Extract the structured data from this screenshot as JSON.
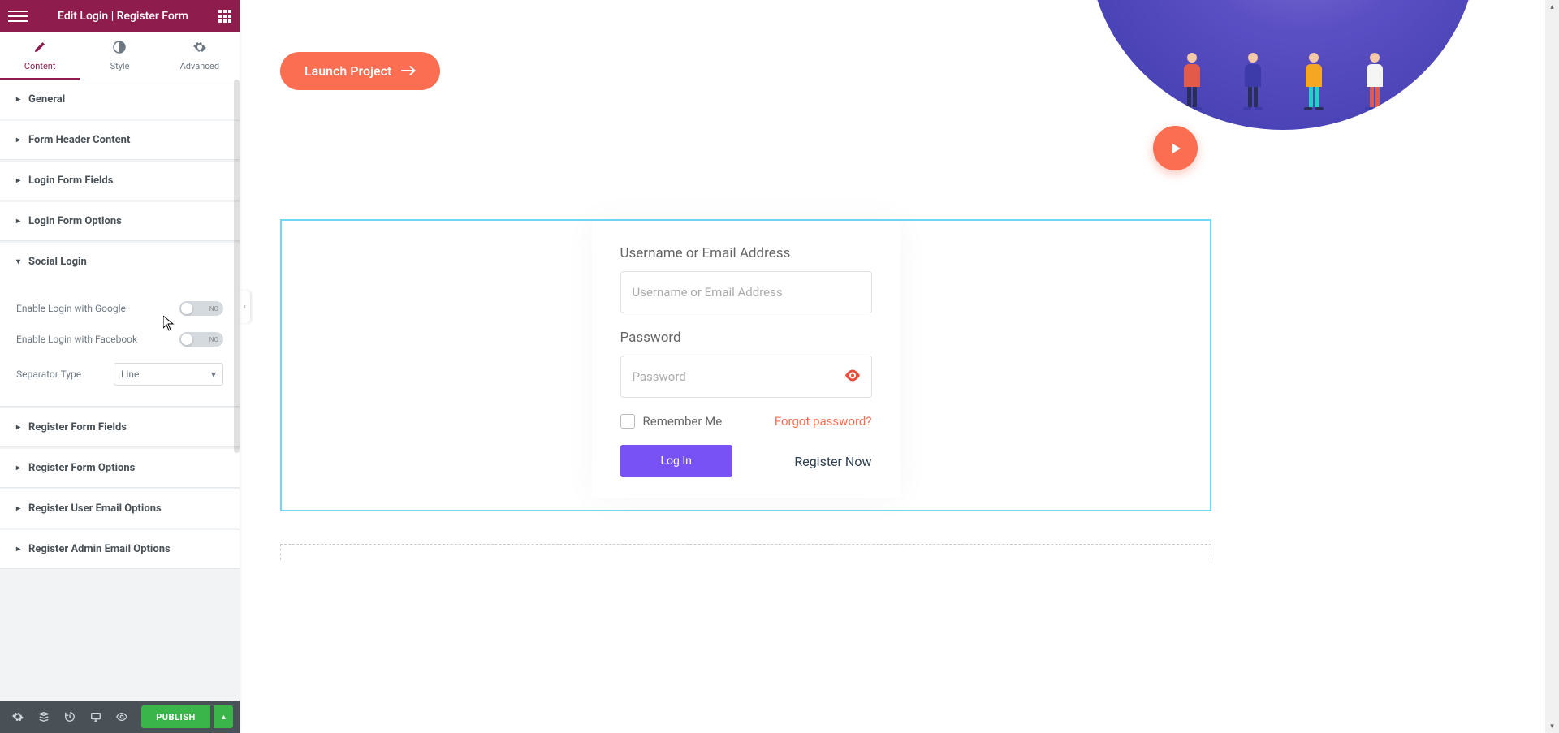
{
  "header": {
    "title": "Edit Login | Register Form"
  },
  "tabs": {
    "content": "Content",
    "style": "Style",
    "advanced": "Advanced"
  },
  "accordion": {
    "general": "General",
    "form_header": "Form Header Content",
    "login_fields": "Login Form Fields",
    "login_options": "Login Form Options",
    "social_login": "Social Login",
    "register_fields": "Register Form Fields",
    "register_options": "Register Form Options",
    "register_user_email": "Register User Email Options",
    "register_admin_email": "Register Admin Email Options"
  },
  "social": {
    "enable_google": "Enable Login with Google",
    "enable_facebook": "Enable Login with Facebook",
    "separator_label": "Separator Type",
    "separator_value": "Line",
    "toggle_no": "NO"
  },
  "footer": {
    "publish": "PUBLISH"
  },
  "canvas": {
    "launch": "Launch Project"
  },
  "form": {
    "username_label": "Username or Email Address",
    "username_placeholder": "Username or Email Address",
    "password_label": "Password",
    "password_placeholder": "Password",
    "remember": "Remember Me",
    "forgot": "Forgot password?",
    "login": "Log In",
    "register": "Register Now"
  }
}
